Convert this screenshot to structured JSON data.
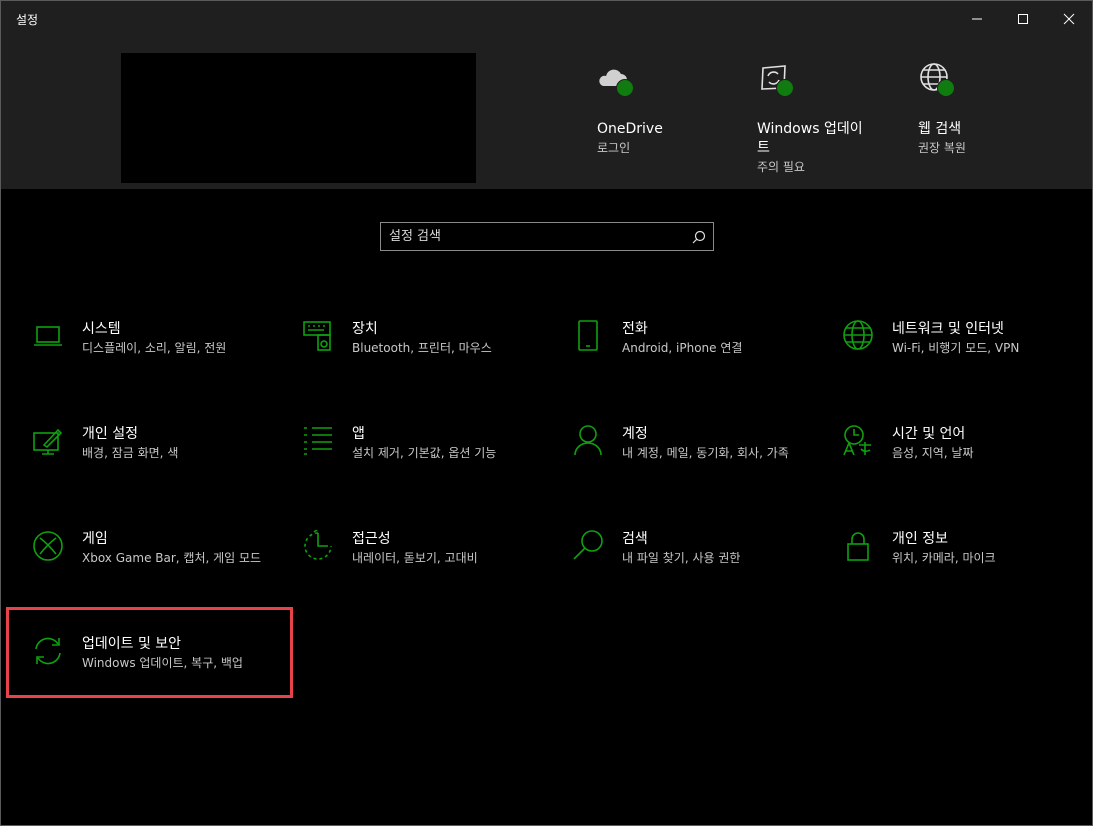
{
  "window": {
    "title": "설정",
    "controls": [
      "minimize-icon",
      "maximize-icon",
      "close-icon"
    ]
  },
  "header": {
    "status": [
      {
        "name": "OneDrive",
        "sub": "로그인",
        "icon": "cloud-icon"
      },
      {
        "name": "Windows 업데이트",
        "sub": "주의 필요",
        "icon": "windows-update-icon"
      },
      {
        "name": "웹 검색",
        "sub": "권장 복원",
        "icon": "globe-icon"
      }
    ],
    "status_color": "#107c10"
  },
  "search": {
    "placeholder": "설정 검색",
    "icon": "search-icon"
  },
  "categories": [
    {
      "name": "시스템",
      "desc": "디스플레이, 소리, 알림, 전원",
      "icon": "laptop-icon"
    },
    {
      "name": "장치",
      "desc": "Bluetooth, 프린터, 마우스",
      "icon": "devices-icon"
    },
    {
      "name": "전화",
      "desc": "Android, iPhone 연결",
      "icon": "phone-icon"
    },
    {
      "name": "네트워크 및 인터넷",
      "desc": "Wi-Fi, 비행기 모드, VPN",
      "icon": "globe-icon"
    },
    {
      "name": "개인 설정",
      "desc": "배경, 잠금 화면, 색",
      "icon": "personalization-icon"
    },
    {
      "name": "앱",
      "desc": "설치 제거, 기본값, 옵션 기능",
      "icon": "apps-list-icon"
    },
    {
      "name": "계정",
      "desc": "내 계정, 메일, 동기화, 회사, 가족",
      "icon": "person-icon"
    },
    {
      "name": "시간 및 언어",
      "desc": "음성, 지역, 날짜",
      "icon": "time-language-icon"
    },
    {
      "name": "게임",
      "desc": "Xbox Game Bar, 캡처, 게임 모드",
      "icon": "xbox-icon"
    },
    {
      "name": "접근성",
      "desc": "내레이터, 돋보기, 고대비",
      "icon": "ease-of-access-icon"
    },
    {
      "name": "검색",
      "desc": "내 파일 찾기, 사용 권한",
      "icon": "search-icon"
    },
    {
      "name": "개인 정보",
      "desc": "위치, 카메라, 마이크",
      "icon": "lock-icon"
    },
    {
      "name": "업데이트 및 보안",
      "desc": "Windows 업데이트, 복구, 백업",
      "icon": "sync-icon"
    }
  ],
  "accent_color": "#10a010",
  "highlight_color": "#e8434a"
}
